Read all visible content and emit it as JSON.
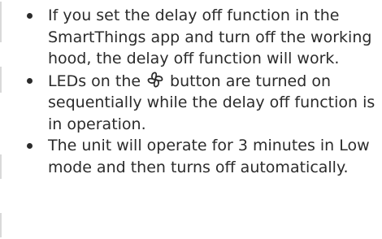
{
  "notes": [
    {
      "text": "If you set the delay off function in the SmartThings app and turn off the working hood, the delay off function will work."
    },
    {
      "text_before_icon": "LEDs on the",
      "icon": "fan-icon",
      "text_after_icon": "button are turned on sequentially while the delay off function is in operation."
    },
    {
      "text": "The unit will operate for 3 minutes in Low mode and then turns off automatically."
    }
  ]
}
